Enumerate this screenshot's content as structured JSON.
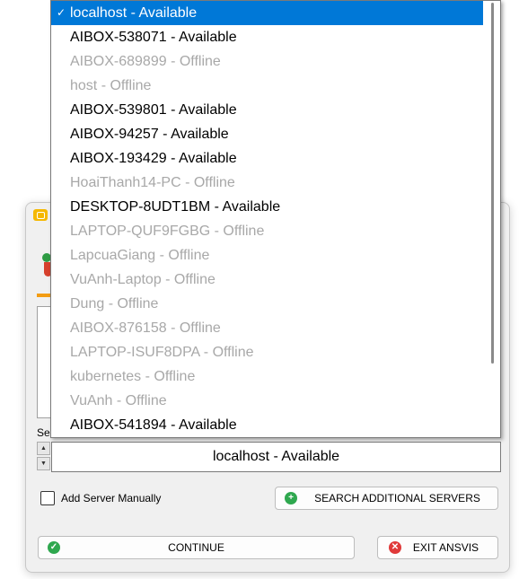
{
  "dropdown": {
    "items": [
      {
        "label": "localhost - Available",
        "status": "available",
        "selected": true
      },
      {
        "label": "AIBOX-538071 - Available",
        "status": "available"
      },
      {
        "label": "AIBOX-689899 - Offline",
        "status": "offline"
      },
      {
        "label": "host - Offline",
        "status": "offline"
      },
      {
        "label": "AIBOX-539801 - Available",
        "status": "available"
      },
      {
        "label": "AIBOX-94257 - Available",
        "status": "available"
      },
      {
        "label": "AIBOX-193429 - Available",
        "status": "available"
      },
      {
        "label": "HoaiThanh14-PC - Offline",
        "status": "offline"
      },
      {
        "label": "DESKTOP-8UDT1BM - Available",
        "status": "available"
      },
      {
        "label": "LAPTOP-QUF9FGBG - Offline",
        "status": "offline"
      },
      {
        "label": "LapcuaGiang - Offline",
        "status": "offline"
      },
      {
        "label": "VuAnh-Laptop - Offline",
        "status": "offline"
      },
      {
        "label": "Dung - Offline",
        "status": "offline"
      },
      {
        "label": "AIBOX-876158 - Offline",
        "status": "offline"
      },
      {
        "label": "LAPTOP-ISUF8DPA - Offline",
        "status": "offline"
      },
      {
        "label": "kubernetes - Offline",
        "status": "offline"
      },
      {
        "label": "VuAnh - Offline",
        "status": "offline"
      },
      {
        "label": "AIBOX-541894 - Available",
        "status": "available"
      }
    ],
    "check_glyph": "✓",
    "selection_color": "#0078d7",
    "offline_color": "#a8a8a8"
  },
  "dialog": {
    "server_label": "Ser",
    "combo_value": "localhost - Available",
    "add_server_label": "Add Server Manually",
    "add_server_checked": false,
    "search_button": "SEARCH ADDITIONAL SERVERS",
    "continue_button": "CONTINUE",
    "exit_button": "EXIT ANSVIS",
    "spin_up": "▲",
    "spin_down": "▼",
    "search_icon": "plus-circle-icon",
    "continue_icon": "check-circle-icon",
    "exit_icon": "x-circle-icon",
    "search_icon_glyph": "+",
    "continue_icon_glyph": "✓",
    "exit_icon_glyph": "✕",
    "accent_green": "#2fa84f",
    "accent_red": "#e03a3a",
    "accent_orange": "#f39c12"
  }
}
